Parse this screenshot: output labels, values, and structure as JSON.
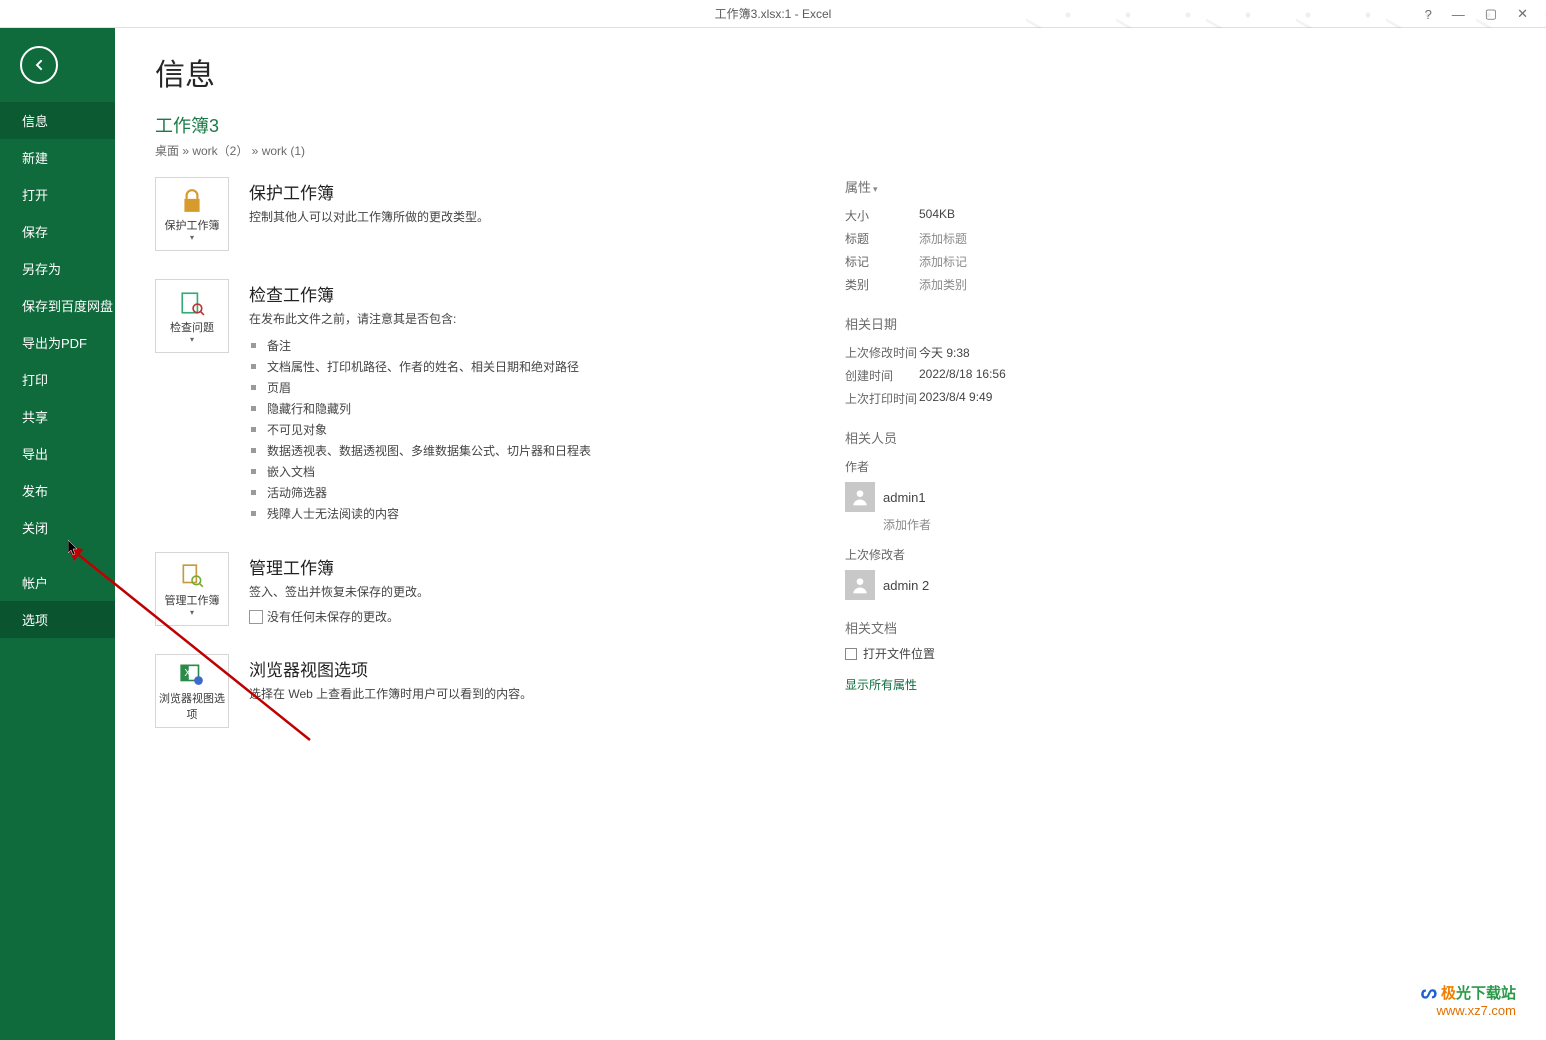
{
  "titlebar": {
    "title": "工作簿3.xlsx:1 - Excel",
    "help": "?",
    "min": "—",
    "max": "▢",
    "close": "✕"
  },
  "sidebar": {
    "items": [
      {
        "label": "信息",
        "active": true
      },
      {
        "label": "新建"
      },
      {
        "label": "打开"
      },
      {
        "label": "保存"
      },
      {
        "label": "另存为"
      },
      {
        "label": "保存到百度网盘"
      },
      {
        "label": "导出为PDF"
      },
      {
        "label": "打印"
      },
      {
        "label": "共享"
      },
      {
        "label": "导出"
      },
      {
        "label": "发布"
      },
      {
        "label": "关闭"
      }
    ],
    "footer": [
      {
        "label": "帐户"
      },
      {
        "label": "选项",
        "highlight": true
      }
    ]
  },
  "page": {
    "title": "信息",
    "workbook_name": "工作簿3",
    "workbook_path": "桌面 » work（2） » work (1)"
  },
  "sections": {
    "protect": {
      "btn": "保护工作簿",
      "title": "保护工作簿",
      "desc": "控制其他人可以对此工作簿所做的更改类型。"
    },
    "inspect": {
      "btn": "检查问题",
      "title": "检查工作簿",
      "desc": "在发布此文件之前，请注意其是否包含:",
      "bullets": [
        "备注",
        "文档属性、打印机路径、作者的姓名、相关日期和绝对路径",
        "页眉",
        "隐藏行和隐藏列",
        "不可见对象",
        "数据透视表、数据透视图、多维数据集公式、切片器和日程表",
        "嵌入文档",
        "活动筛选器",
        "残障人士无法阅读的内容"
      ]
    },
    "manage": {
      "btn": "管理工作簿",
      "title": "管理工作簿",
      "desc": "签入、签出并恢复未保存的更改。",
      "none": "没有任何未保存的更改。"
    },
    "browser": {
      "btn": "浏览器视图选项",
      "title": "浏览器视图选项",
      "desc": "选择在 Web 上查看此工作簿时用户可以看到的内容。"
    }
  },
  "props": {
    "header": "属性",
    "rows": {
      "size_label": "大小",
      "size_value": "504KB",
      "title_label": "标题",
      "title_value": "添加标题",
      "tag_label": "标记",
      "tag_value": "添加标记",
      "cat_label": "类别",
      "cat_value": "添加类别"
    },
    "dates": {
      "header": "相关日期",
      "modified_label": "上次修改时间",
      "modified_value": "今天 9:38",
      "created_label": "创建时间",
      "created_value": "2022/8/18 16:56",
      "printed_label": "上次打印时间",
      "printed_value": "2023/8/4 9:49"
    },
    "people": {
      "header": "相关人员",
      "author_label": "作者",
      "author_name": "admin1",
      "add_author": "添加作者",
      "modifier_label": "上次修改者",
      "modifier_name": "admin 2"
    },
    "docs": {
      "header": "相关文档",
      "file_location": "打开文件位置"
    },
    "show_all": "显示所有属性"
  },
  "watermark": {
    "brand1": "极",
    "brand2": "光下载站",
    "url": "www.xz7.com"
  }
}
